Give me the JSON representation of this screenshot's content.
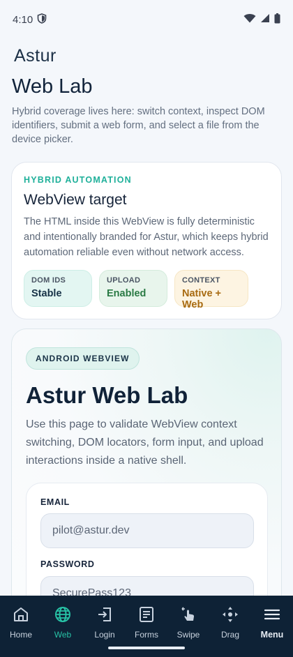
{
  "status_bar": {
    "time": "4:10"
  },
  "brand": {
    "logo_text": "Astur"
  },
  "page": {
    "title": "Web Lab",
    "description": "Hybrid coverage lives here: switch context, inspect DOM identifiers, submit a web form, and select a file from the device picker."
  },
  "hybrid_card": {
    "eyebrow": "HYBRID AUTOMATION",
    "title": "WebView target",
    "description": "The HTML inside this WebView is fully deterministic and intentionally branded for Astur, which keeps hybrid automation reliable even without network access.",
    "pills": [
      {
        "label": "DOM IDS",
        "value": "Stable"
      },
      {
        "label": "UPLOAD",
        "value": "Enabled"
      },
      {
        "label": "CONTEXT",
        "value": "Native + Web"
      }
    ]
  },
  "webview": {
    "badge": "ANDROID WEBVIEW",
    "title": "Astur Web Lab",
    "description": "Use this page to validate WebView context switching, DOM locators, form input, and upload interactions inside a native shell.",
    "form": {
      "email_label": "EMAIL",
      "email_value": "pilot@astur.dev",
      "password_label": "PASSWORD",
      "password_value": "SecurePass123"
    }
  },
  "bottom_nav": {
    "active": "Web",
    "items": [
      {
        "label": "Home",
        "icon": "home-icon"
      },
      {
        "label": "Web",
        "icon": "globe-icon"
      },
      {
        "label": "Login",
        "icon": "login-icon"
      },
      {
        "label": "Forms",
        "icon": "form-icon"
      },
      {
        "label": "Swipe",
        "icon": "swipe-icon"
      },
      {
        "label": "Drag",
        "icon": "drag-icon"
      },
      {
        "label": "Menu",
        "icon": "menu-icon"
      }
    ]
  },
  "colors": {
    "accent": "#27c1a5",
    "nav_background": "#0e2236",
    "eyebrow": "#1fb09a"
  }
}
